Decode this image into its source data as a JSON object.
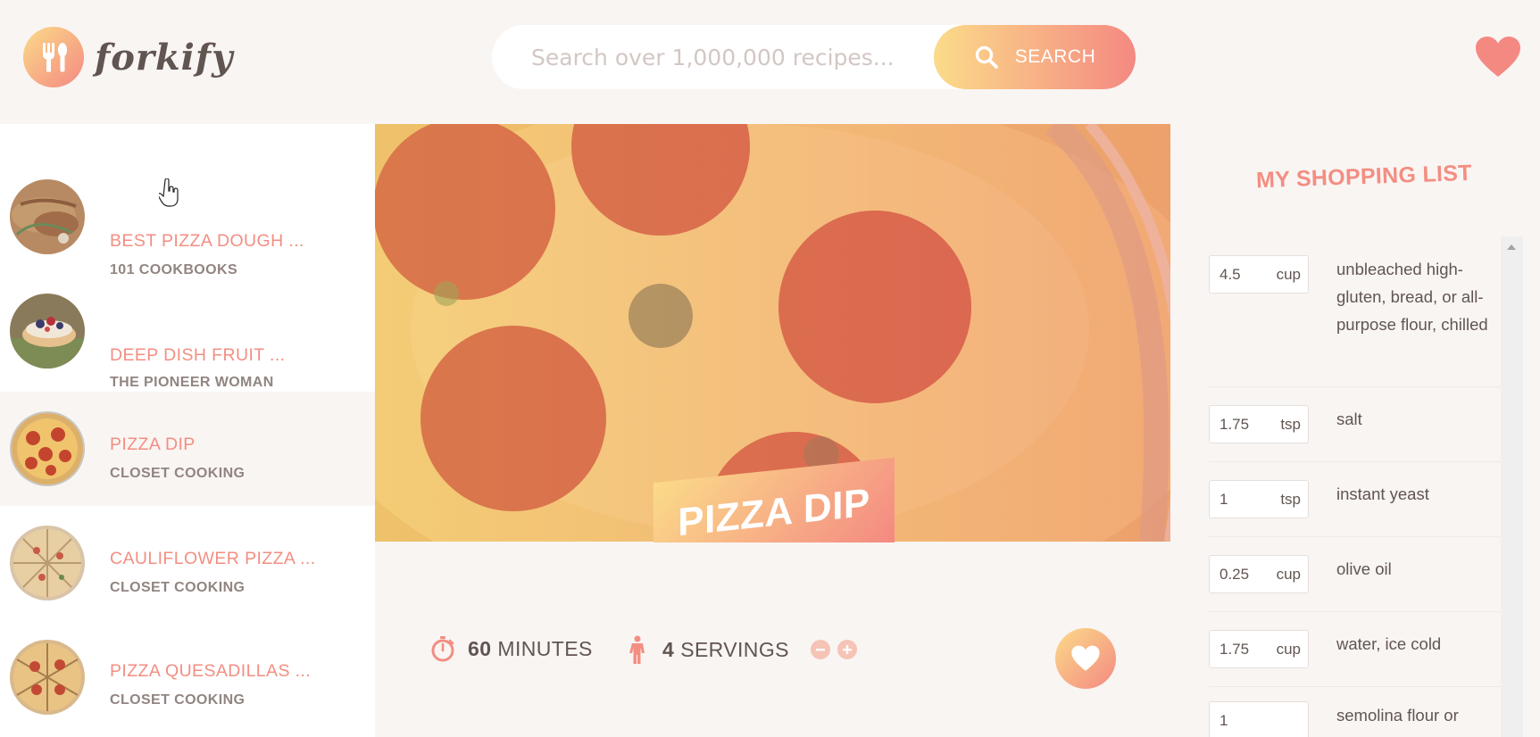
{
  "app": {
    "name": "forkify"
  },
  "search": {
    "placeholder": "Search over 1,000,000 recipes...",
    "button_label": "SEARCH"
  },
  "results": [
    {
      "title": "BEST PIZZA DOUGH ...",
      "author": "101 COOKBOOKS",
      "active": false
    },
    {
      "title": "DEEP DISH FRUIT ...",
      "author": "THE PIONEER WOMAN",
      "active": false
    },
    {
      "title": "PIZZA DIP",
      "author": "CLOSET COOKING",
      "active": true
    },
    {
      "title": "CAULIFLOWER PIZZA ...",
      "author": "CLOSET COOKING",
      "active": false
    },
    {
      "title": "PIZZA QUESADILLAS ...",
      "author": "CLOSET COOKING",
      "active": false
    }
  ],
  "recipe": {
    "title": "PIZZA DIP",
    "time_value": "60",
    "time_unit": "MINUTES",
    "servings_value": "4",
    "servings_unit": "SERVINGS"
  },
  "shopping": {
    "title": "MY SHOPPING LIST",
    "items": [
      {
        "count": "4.5",
        "unit": "cup",
        "description": "unbleached high-gluten, bread, or all-purpose flour, chilled"
      },
      {
        "count": "1.75",
        "unit": "tsp",
        "description": "salt"
      },
      {
        "count": "1",
        "unit": "tsp",
        "description": "instant yeast"
      },
      {
        "count": "0.25",
        "unit": "cup",
        "description": "olive oil"
      },
      {
        "count": "1.75",
        "unit": "cup",
        "description": "water, ice cold"
      },
      {
        "count": "1",
        "unit": "",
        "description": "semolina flour or"
      }
    ]
  },
  "colors": {
    "accent_start": "#fbdb89",
    "accent_end": "#f48982",
    "title_text": "#f38e82",
    "body_text": "#615551",
    "background": "#f9f5f3"
  },
  "icons": {
    "logo": "fork-spoon-icon",
    "search": "search-icon",
    "likes": "heart-icon",
    "time": "stopwatch-icon",
    "servings": "person-icon",
    "decrease": "minus-circle-icon",
    "increase": "plus-circle-icon",
    "love": "heart-icon"
  }
}
